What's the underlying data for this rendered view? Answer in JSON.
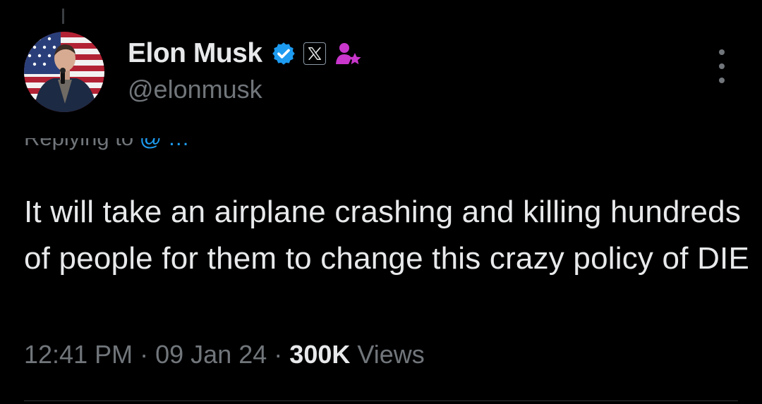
{
  "author": {
    "name": "Elon Musk",
    "handle": "@elonmusk",
    "verified": true,
    "affiliate_badge": "x-logo-icon",
    "extra_badge": "person-star-icon"
  },
  "reply_context": {
    "label": "Replying to",
    "mention": "@  …"
  },
  "tweet": {
    "text": "It will take an airplane crashing and killing hundreds of people for them to change this crazy policy of DIE"
  },
  "meta": {
    "time": "12:41 PM",
    "separator": "·",
    "date": "09 Jan 24",
    "views_count": "300K",
    "views_label": "Views"
  },
  "colors": {
    "background": "#000000",
    "primary_text": "#e7e9ea",
    "secondary_text": "#71767b",
    "verified_blue": "#1d9bf0",
    "badge_purple": "#c936cc"
  }
}
